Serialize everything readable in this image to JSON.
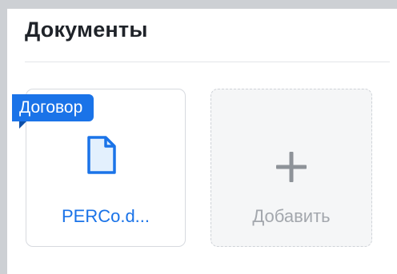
{
  "panel": {
    "title": "Документы"
  },
  "documents": [
    {
      "tag": "Договор",
      "icon": "file-icon",
      "name": "PERCo.d..."
    }
  ],
  "add_card": {
    "icon": "plus-icon",
    "label": "Добавить"
  },
  "colors": {
    "accent": "#1a73e8",
    "file_icon_fill": "#e3f0fd",
    "muted_text": "#a3a7ad",
    "title_text": "#1f2329",
    "add_card_bg": "#f5f6f7"
  }
}
